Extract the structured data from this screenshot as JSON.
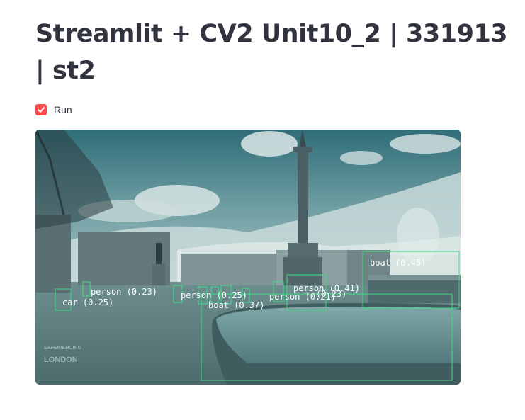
{
  "page": {
    "title": "Streamlit + CV2 Unit10_2 | 331913 | st2"
  },
  "run_checkbox": {
    "label": "Run",
    "checked": true,
    "accent_color": "#ff4b4b"
  },
  "video_frame": {
    "watermark_line1": "EXPERIENCING",
    "watermark_line2": "LONDON",
    "box_color": "#3ddc84",
    "detections": [
      {
        "label": "boat (0.45)"
      },
      {
        "label": "person (0.41)"
      },
      {
        "label": "person (0.23)"
      },
      {
        "label": "car (0.25)"
      },
      {
        "label": "boat (0.37)"
      },
      {
        "label": "person (0.25)"
      },
      {
        "label": "person (0.21)"
      },
      {
        "label": "(0.23)"
      }
    ]
  }
}
